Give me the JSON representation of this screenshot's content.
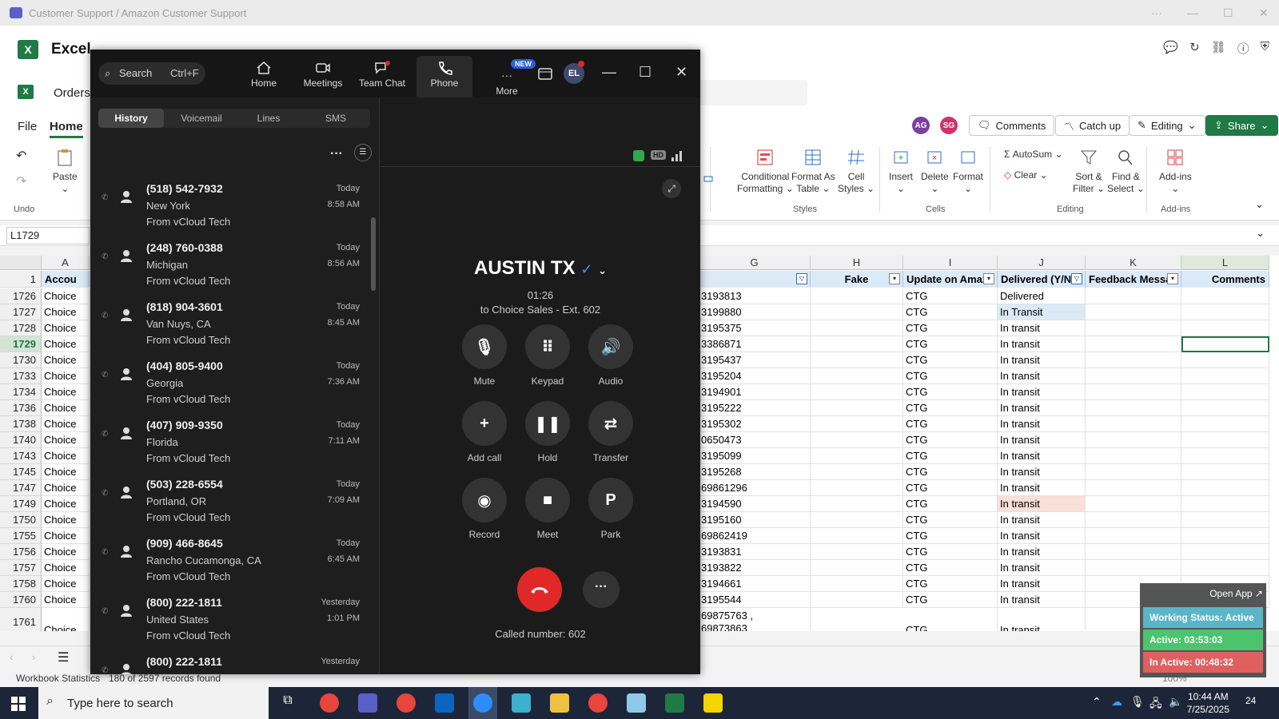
{
  "teams_bar": {
    "title": "Customer Support / Amazon Customer Support"
  },
  "excel": {
    "app_name": "Excel",
    "doc_name": "Orders",
    "tabs": [
      "File",
      "Home"
    ],
    "avatars": [
      "AG",
      "SG"
    ],
    "actions": {
      "comments": "Comments",
      "catch_up": "Catch up",
      "editing": "Editing",
      "share": "Share"
    },
    "ribbon": {
      "undo": "Undo",
      "paste": "Paste",
      "cond_format": "Conditional",
      "cond_format2": "Formatting",
      "format_table": "Format As",
      "format_table2": "Table",
      "cell_styles": "Cell",
      "cell_styles2": "Styles",
      "insert": "Insert",
      "delete": "Delete",
      "format": "Format",
      "autosum": "AutoSum",
      "clear": "Clear",
      "sort": "Sort &",
      "sort2": "Filter",
      "find": "Find &",
      "find2": "Select",
      "addins": "Add-ins",
      "group_undo": "Undo",
      "group_styles": "Styles",
      "group_cells": "Cells",
      "group_editing": "Editing",
      "group_addins": "Add-ins"
    },
    "name_box": "L1729",
    "columns": [
      "A",
      "G",
      "H",
      "I",
      "J",
      "K",
      "L"
    ],
    "header_row_num": "1",
    "headers": {
      "A": "Accou",
      "H": "Fake",
      "I": "Update on Amaz",
      "J": "Delivered (Y/N",
      "K": "Feedback Messa",
      "L": "Comments"
    },
    "rows": [
      {
        "n": "1726",
        "a": "Choice",
        "g": "3193813",
        "i": "CTG",
        "j": "Delivered"
      },
      {
        "n": "1727",
        "a": "Choice",
        "g": "3199880",
        "i": "CTG",
        "j": "In Transit"
      },
      {
        "n": "1728",
        "a": "Choice",
        "g": "3195375",
        "i": "CTG",
        "j": "In transit"
      },
      {
        "n": "1729",
        "a": "Choice",
        "g": "3386871",
        "i": "CTG",
        "j": "In transit"
      },
      {
        "n": "1730",
        "a": "Choice",
        "g": "3195437",
        "i": "CTG",
        "j": "In transit"
      },
      {
        "n": "1733",
        "a": "Choice",
        "g": "3195204",
        "i": "CTG",
        "j": "In transit"
      },
      {
        "n": "1734",
        "a": "Choice",
        "g": "3194901",
        "i": "CTG",
        "j": "In transit"
      },
      {
        "n": "1736",
        "a": "Choice",
        "g": "3195222",
        "i": "CTG",
        "j": "In transit"
      },
      {
        "n": "1738",
        "a": "Choice",
        "g": "3195302",
        "i": "CTG",
        "j": "In transit"
      },
      {
        "n": "1740",
        "a": "Choice",
        "g": "0650473",
        "i": "CTG",
        "j": "In transit"
      },
      {
        "n": "1743",
        "a": "Choice",
        "g": "3195099",
        "i": "CTG",
        "j": "In transit"
      },
      {
        "n": "1745",
        "a": "Choice",
        "g": "3195268",
        "i": "CTG",
        "j": "In transit"
      },
      {
        "n": "1747",
        "a": "Choice",
        "g": "69861296",
        "i": "CTG",
        "j": "In transit"
      },
      {
        "n": "1749",
        "a": "Choice",
        "g": "3194590",
        "i": "CTG",
        "j": "In transit"
      },
      {
        "n": "1750",
        "a": "Choice",
        "g": "3195160",
        "i": "CTG",
        "j": "In transit"
      },
      {
        "n": "1755",
        "a": "Choice",
        "g": "69862419",
        "i": "CTG",
        "j": "In transit"
      },
      {
        "n": "1756",
        "a": "Choice",
        "g": "3193831",
        "i": "CTG",
        "j": "In transit"
      },
      {
        "n": "1757",
        "a": "Choice",
        "g": "3193822",
        "i": "CTG",
        "j": "In transit"
      },
      {
        "n": "1758",
        "a": "Choice",
        "g": "3194661",
        "i": "CTG",
        "j": "In transit"
      },
      {
        "n": "1760",
        "a": "Choice",
        "g": "3195544",
        "i": "CTG",
        "j": "In transit"
      }
    ],
    "last_row": {
      "n": "1761",
      "a": "Choice",
      "g1": "69875763 ,",
      "g2": "69873863",
      "i": "CTG",
      "j": "In transit"
    },
    "status": {
      "stats": "Workbook Statistics",
      "records": "180 of 2597 records found",
      "zoom": "100%"
    }
  },
  "zoom": {
    "search_placeholder": "Search",
    "search_shortcut": "Ctrl+F",
    "nav": [
      "Home",
      "Meetings",
      "Team Chat",
      "Phone",
      "More"
    ],
    "new_badge": "NEW",
    "avatar": "EL",
    "seg_tabs": [
      "History",
      "Voicemail",
      "Lines",
      "SMS"
    ],
    "calls": [
      {
        "num": "(518) 542-7932",
        "loc": "New York",
        "src": "From vCloud Tech",
        "day": "Today",
        "time": "8:58 AM"
      },
      {
        "num": "(248) 760-0388",
        "loc": "Michigan",
        "src": "From vCloud Tech",
        "day": "Today",
        "time": "8:56 AM"
      },
      {
        "num": "(818) 904-3601",
        "loc": "Van Nuys, CA",
        "src": "From vCloud Tech",
        "day": "Today",
        "time": "8:45 AM"
      },
      {
        "num": "(404) 805-9400",
        "loc": "Georgia",
        "src": "From vCloud Tech",
        "day": "Today",
        "time": "7:36 AM"
      },
      {
        "num": "(407) 909-9350",
        "loc": "Florida",
        "src": "From vCloud Tech",
        "day": "Today",
        "time": "7:11 AM"
      },
      {
        "num": "(503) 228-6554",
        "loc": "Portland, OR",
        "src": "From vCloud Tech",
        "day": "Today",
        "time": "7:09 AM"
      },
      {
        "num": "(909) 466-8645",
        "loc": "Rancho Cucamonga, CA",
        "src": "From vCloud Tech",
        "day": "Today",
        "time": "6:45 AM"
      },
      {
        "num": "(800) 222-1811",
        "loc": "United States",
        "src": "From vCloud Tech",
        "day": "Yesterday",
        "time": "1:01 PM"
      },
      {
        "num": "(800) 222-1811",
        "loc": "",
        "src": "",
        "day": "Yesterday",
        "time": ""
      }
    ],
    "active_call": {
      "callee": "AUSTIN TX",
      "timer": "01:26",
      "to": "to Choice Sales - Ext. 602",
      "controls": [
        "Mute",
        "Keypad",
        "Audio",
        "Add call",
        "Hold",
        "Transfer",
        "Record",
        "Meet",
        "Park"
      ],
      "park_glyph": "P",
      "called_number": "Called number: 602",
      "hd": "HD"
    }
  },
  "work_status": {
    "open_app": "Open App ↗",
    "status": "Working Status: Active",
    "active": "Active: 03:53:03",
    "inactive": "In Active: 00:48:32",
    "colors": {
      "status": "#5bb5c9",
      "active": "#4cc46e",
      "inactive": "#e06060"
    }
  },
  "taskbar": {
    "search_placeholder": "Type here to search",
    "time": "10:44 AM",
    "date": "7/25/2025",
    "notif": "24"
  }
}
